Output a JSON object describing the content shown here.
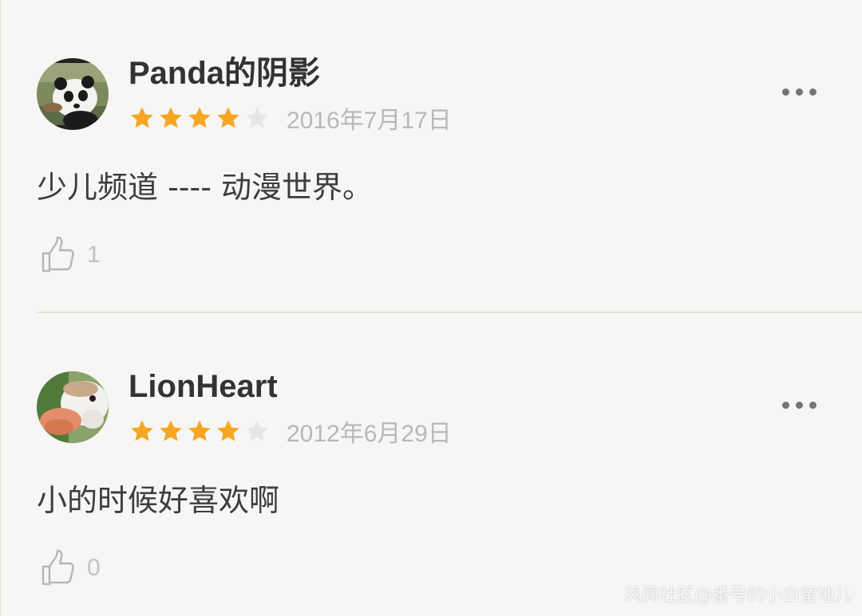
{
  "reviews": [
    {
      "username": "Panda的阴影",
      "avatar_icon": "panda-avatar",
      "rating": 4,
      "max_rating": 5,
      "date": "2016年7月17日",
      "comment": "少儿频道 ---- 动漫世界。",
      "likes": "1"
    },
    {
      "username": "LionHeart",
      "avatar_icon": "hamster-avatar",
      "rating": 4,
      "max_rating": 5,
      "date": "2012年6月29日",
      "comment": "小的时候好喜欢啊",
      "likes": "0"
    }
  ],
  "colors": {
    "star_filled": "#f5a623",
    "star_empty": "#e6e6e6",
    "background": "#f7f6f4"
  },
  "watermark": "风闻社区@番号的小白留地儿"
}
